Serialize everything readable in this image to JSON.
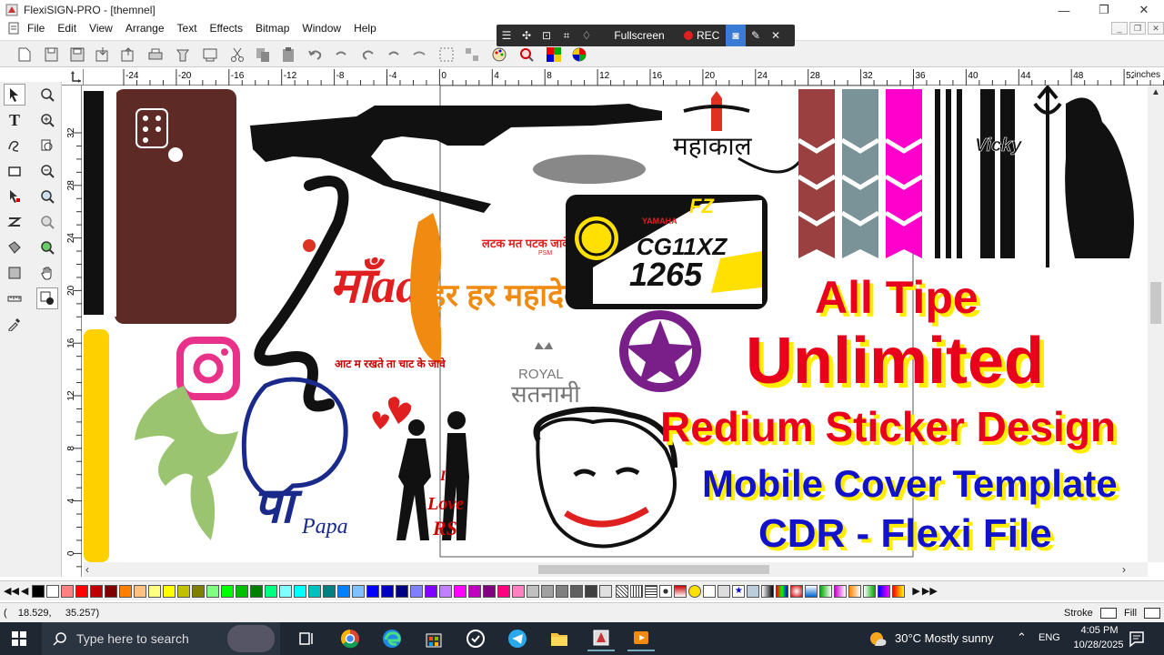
{
  "window": {
    "title": "FlexiSIGN-PRO - [themnel]",
    "minimize": "—",
    "maximize": "❐",
    "close": "✕"
  },
  "menu": [
    "File",
    "Edit",
    "View",
    "Arrange",
    "Text",
    "Effects",
    "Bitmap",
    "Window",
    "Help"
  ],
  "recorder": {
    "fullscreen_label": "Fullscreen",
    "rec_label": "REC"
  },
  "ruler": {
    "unit_label": "inches",
    "h_ticks": [
      "-24",
      "-20",
      "-16",
      "-12",
      "-8",
      "-4",
      "0",
      "4",
      "8",
      "12",
      "16",
      "20",
      "24",
      "28",
      "32",
      "36",
      "40",
      "44",
      "48",
      "52"
    ],
    "v_ticks": [
      "32",
      "28",
      "24",
      "20",
      "16",
      "12",
      "8",
      "4",
      "0"
    ]
  },
  "artwork": {
    "maa_text": "माँaa",
    "tagline_top": "लटक मत पटक जावे",
    "tagline_top_tag": "PSM",
    "har_har": "हर हर महादेव",
    "aaj_text": "आट म रखते ता चाट के जावे",
    "royal": "ROYAL",
    "satnami": "सतनामी",
    "mahakal": "महाकाल",
    "vicky": "Vicky",
    "plate_brand": "YAMAHA",
    "plate_model": "FZ",
    "plate_line1": "CG11XZ",
    "plate_line2": "1265",
    "love_line1": "I",
    "love_line2": "Love",
    "love_line3": "RS",
    "papa": "Papa"
  },
  "promo": {
    "line1": "All Tipe",
    "line2": "Unlimited",
    "line3": "Redium Sticker Design",
    "line4": "Mobile Cover Template",
    "line5": "CDR - Flexi File"
  },
  "status": {
    "coords": "(    18.529,     35.257)",
    "stroke_label": "Stroke",
    "fill_label": "Fill"
  },
  "taskbar": {
    "search_placeholder": "Type here to search",
    "weather": "30°C  Mostly sunny",
    "lang": "ENG",
    "time": "4:05 PM",
    "date": "10/28/2025"
  },
  "palette_colors": [
    "#000000",
    "#ffffff",
    "#ff8080",
    "#ff0000",
    "#c00000",
    "#800000",
    "#ff8000",
    "#ffc080",
    "#ffff80",
    "#ffff00",
    "#c0c000",
    "#808000",
    "#80ff80",
    "#00ff00",
    "#00c000",
    "#008000",
    "#00ff80",
    "#80ffff",
    "#00ffff",
    "#00c0c0",
    "#008080",
    "#0080ff",
    "#80c0ff",
    "#0000ff",
    "#0000c0",
    "#000080",
    "#8080ff",
    "#8000ff",
    "#c080ff",
    "#ff00ff",
    "#c000c0",
    "#800080",
    "#ff0080",
    "#ff80c0",
    "#c0c0c0",
    "#a0a0a0",
    "#808080",
    "#606060",
    "#404040",
    "#e0e0e0"
  ],
  "colors": {
    "promo_red": "#e8001c",
    "promo_blue": "#1212c8",
    "promo_shadow": "#ffee00",
    "taskbar": "#1f2733"
  }
}
